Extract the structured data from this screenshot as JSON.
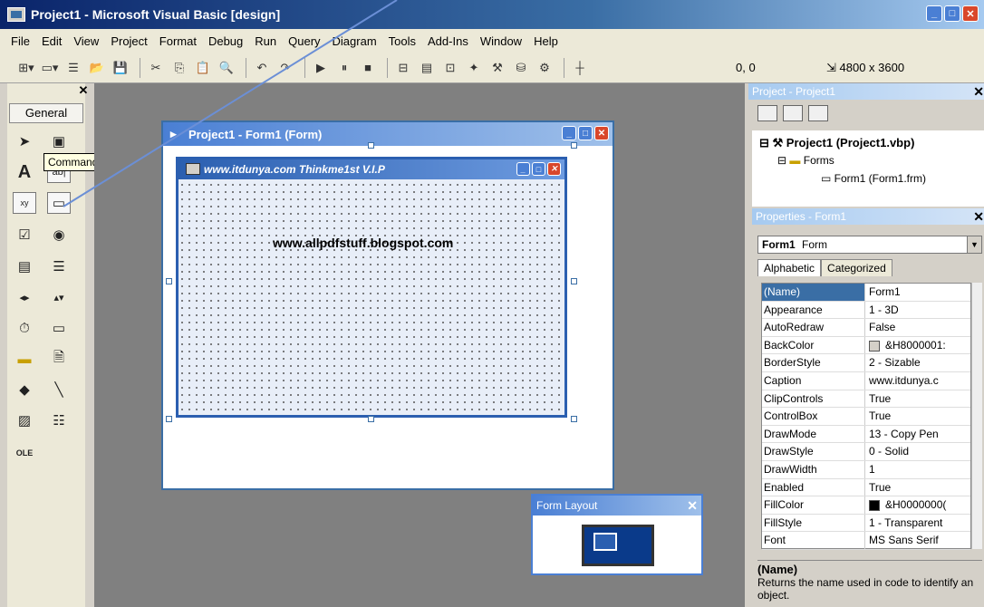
{
  "window": {
    "title": "Project1 - Microsoft Visual Basic [design]"
  },
  "menu": [
    "File",
    "Edit",
    "View",
    "Project",
    "Format",
    "Debug",
    "Run",
    "Query",
    "Diagram",
    "Tools",
    "Add-Ins",
    "Window",
    "Help"
  ],
  "toolbar": {
    "coords": "0, 0",
    "size": "4800 x 3600"
  },
  "toolbox": {
    "tab_label": "General",
    "tooltip": "CommandButton"
  },
  "designer": {
    "title": "Project1 - Form1 (Form)"
  },
  "form": {
    "caption": "www.itdunya.com  Thinkme1st V.I.P",
    "watermark": "www.allpdfstuff.blogspot.com"
  },
  "layout": {
    "title": "Form Layout"
  },
  "project": {
    "title": "Project - Project1",
    "root": "Project1 (Project1.vbp)",
    "folder": "Forms",
    "form_item": "Form1 (Form1.frm)"
  },
  "properties": {
    "title": "Properties - Form1",
    "object_name": "Form1",
    "object_type": "Form",
    "tabs": [
      "Alphabetic",
      "Categorized"
    ],
    "rows": [
      {
        "k": "(Name)",
        "v": "Form1"
      },
      {
        "k": "Appearance",
        "v": "1 - 3D"
      },
      {
        "k": "AutoRedraw",
        "v": "False"
      },
      {
        "k": "BackColor",
        "v": "&H8000001:"
      },
      {
        "k": "BorderStyle",
        "v": "2 - Sizable"
      },
      {
        "k": "Caption",
        "v": "www.itdunya.c"
      },
      {
        "k": "ClipControls",
        "v": "True"
      },
      {
        "k": "ControlBox",
        "v": "True"
      },
      {
        "k": "DrawMode",
        "v": "13 - Copy Pen"
      },
      {
        "k": "DrawStyle",
        "v": "0 - Solid"
      },
      {
        "k": "DrawWidth",
        "v": "1"
      },
      {
        "k": "Enabled",
        "v": "True"
      },
      {
        "k": "FillColor",
        "v": "&H0000000("
      },
      {
        "k": "FillStyle",
        "v": "1 - Transparent"
      },
      {
        "k": "Font",
        "v": "MS Sans Serif"
      }
    ],
    "desc_title": "(Name)",
    "desc_text": "Returns the name used in code to identify an object."
  }
}
